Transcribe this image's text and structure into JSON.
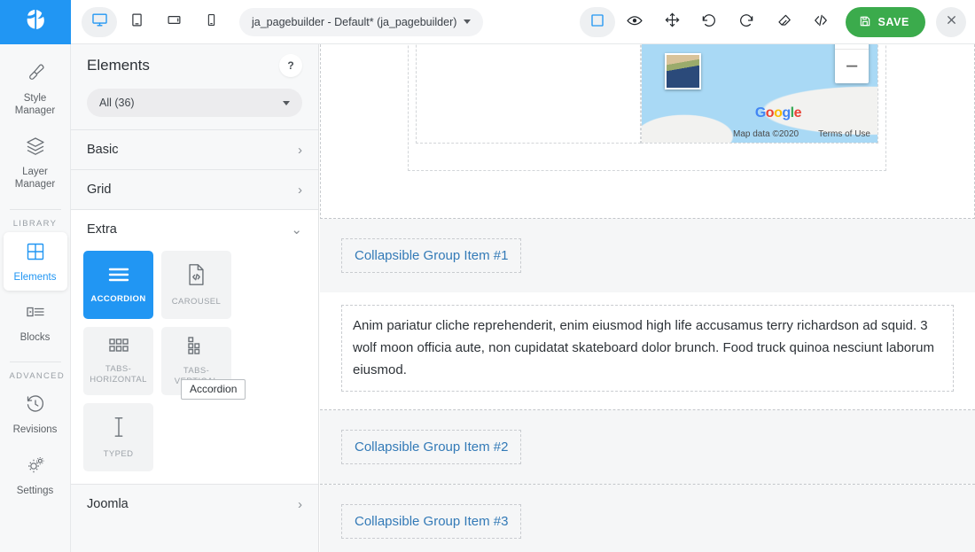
{
  "brand": {
    "logo_icon": "leaf-logo-icon",
    "accent": "#2196f3",
    "save_color": "#3bab4c"
  },
  "topbar": {
    "devices": [
      {
        "name": "desktop",
        "icon": "desktop-icon",
        "active": true
      },
      {
        "name": "tablet",
        "icon": "tablet-portrait-icon",
        "active": false
      },
      {
        "name": "tablet-landscape",
        "icon": "tablet-landscape-icon",
        "active": false
      },
      {
        "name": "mobile",
        "icon": "mobile-icon",
        "active": false
      }
    ],
    "document_selector": {
      "label": "ja_pagebuilder - Default* (ja_pagebuilder)"
    },
    "actions": [
      {
        "name": "outline-toggle",
        "icon": "square-outline-icon",
        "selected": true
      },
      {
        "name": "preview",
        "icon": "eye-icon",
        "selected": false
      },
      {
        "name": "move",
        "icon": "move-arrows-icon",
        "selected": false
      },
      {
        "name": "undo",
        "icon": "undo-icon",
        "selected": false
      },
      {
        "name": "redo",
        "icon": "redo-icon",
        "selected": false
      },
      {
        "name": "clear",
        "icon": "eraser-icon",
        "selected": false
      },
      {
        "name": "code-view",
        "icon": "code-brackets-icon",
        "selected": false
      }
    ],
    "save_label": "SAVE",
    "save_icon": "floppy-disk-icon",
    "close_icon": "close-x-icon"
  },
  "rail": {
    "items": [
      {
        "label": "Style Manager",
        "icon": "brush-icon",
        "active": false
      },
      {
        "label": "Layer Manager",
        "icon": "layers-icon",
        "active": false
      }
    ],
    "section_library": "LIBRARY",
    "library_items": [
      {
        "label": "Elements",
        "icon": "grid-squares-icon",
        "active": true
      },
      {
        "label": "Blocks",
        "icon": "blocks-list-icon",
        "active": false
      }
    ],
    "section_advanced": "ADVANCED",
    "advanced_items": [
      {
        "label": "Revisions",
        "icon": "history-clock-icon",
        "active": false
      },
      {
        "label": "Settings",
        "icon": "gears-icon",
        "active": false
      }
    ]
  },
  "panel": {
    "title": "Elements",
    "help_label": "?",
    "filter_value": "All (36)",
    "sections": [
      {
        "label": "Basic",
        "expanded": false,
        "chevron": "›"
      },
      {
        "label": "Grid",
        "expanded": false,
        "chevron": "›"
      },
      {
        "label": "Extra",
        "expanded": true,
        "chevron": "⌄"
      },
      {
        "label": "Joomla",
        "expanded": false,
        "chevron": "›"
      }
    ],
    "extra_cards": [
      {
        "label": "ACCORDION",
        "icon": "accordion-lines-icon",
        "active": true
      },
      {
        "label": "CAROUSEL",
        "icon": "code-file-icon",
        "active": false
      },
      {
        "label": "TABS-HORIZONTAL",
        "icon": "tabs-horizontal-grid-icon",
        "active": false
      },
      {
        "label": "TABS-VERTICAL",
        "icon": "tabs-vertical-grid-icon",
        "active": false
      },
      {
        "label": "TYPED",
        "icon": "text-cursor-icon",
        "active": false
      }
    ],
    "tooltip": "Accordion"
  },
  "canvas": {
    "map": {
      "google_logo": "Google",
      "google_letters": [
        "G",
        "o",
        "o",
        "g",
        "l",
        "e"
      ],
      "map_data": "Map data ©2020",
      "terms": "Terms of Use",
      "zoom_in": "+",
      "zoom_out": "−"
    },
    "accordion_items": [
      {
        "title": "Collapsible Group Item #1",
        "expanded": true,
        "body": "Anim pariatur cliche reprehenderit, enim eiusmod high life accusamus terry richardson ad squid. 3 wolf moon officia aute, non cupidatat skateboard dolor brunch. Food truck quinoa nesciunt laborum eiusmod."
      },
      {
        "title": "Collapsible Group Item #2",
        "expanded": false,
        "body": ""
      },
      {
        "title": "Collapsible Group Item #3",
        "expanded": false,
        "body": ""
      }
    ]
  }
}
